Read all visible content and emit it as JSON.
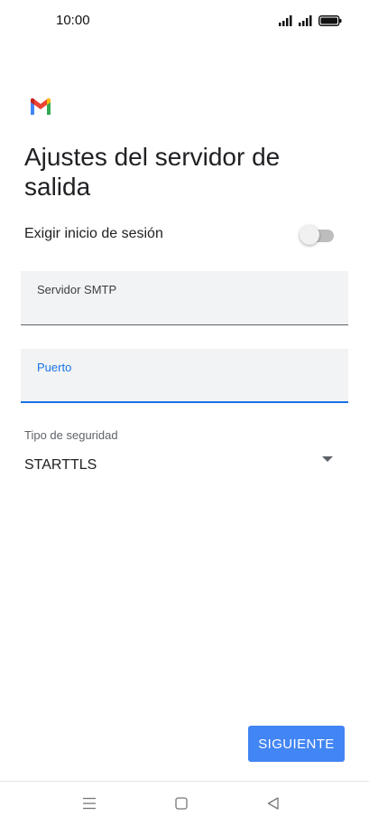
{
  "status_bar": {
    "time": "10:00",
    "icons": [
      "signal-icon",
      "signal-icon",
      "battery-icon"
    ]
  },
  "app": {
    "logo_icon": "gmail-logo-icon",
    "title": "Ajustes del servidor de salida"
  },
  "form": {
    "require_login": {
      "label": "Exigir inicio de sesión",
      "enabled": false
    },
    "smtp_server": {
      "label": "Servidor SMTP",
      "value": ""
    },
    "port": {
      "label": "Puerto",
      "value": ""
    },
    "security_type": {
      "label": "Tipo de seguridad",
      "value": "STARTTLS"
    }
  },
  "actions": {
    "next_label": "SIGUIENTE"
  },
  "nav_bar": {
    "icons": [
      "menu-icon",
      "home-icon",
      "back-icon"
    ]
  },
  "colors": {
    "accent": "#1a73e8",
    "button": "#4285f4",
    "field_bg": "#f1f3f4"
  }
}
